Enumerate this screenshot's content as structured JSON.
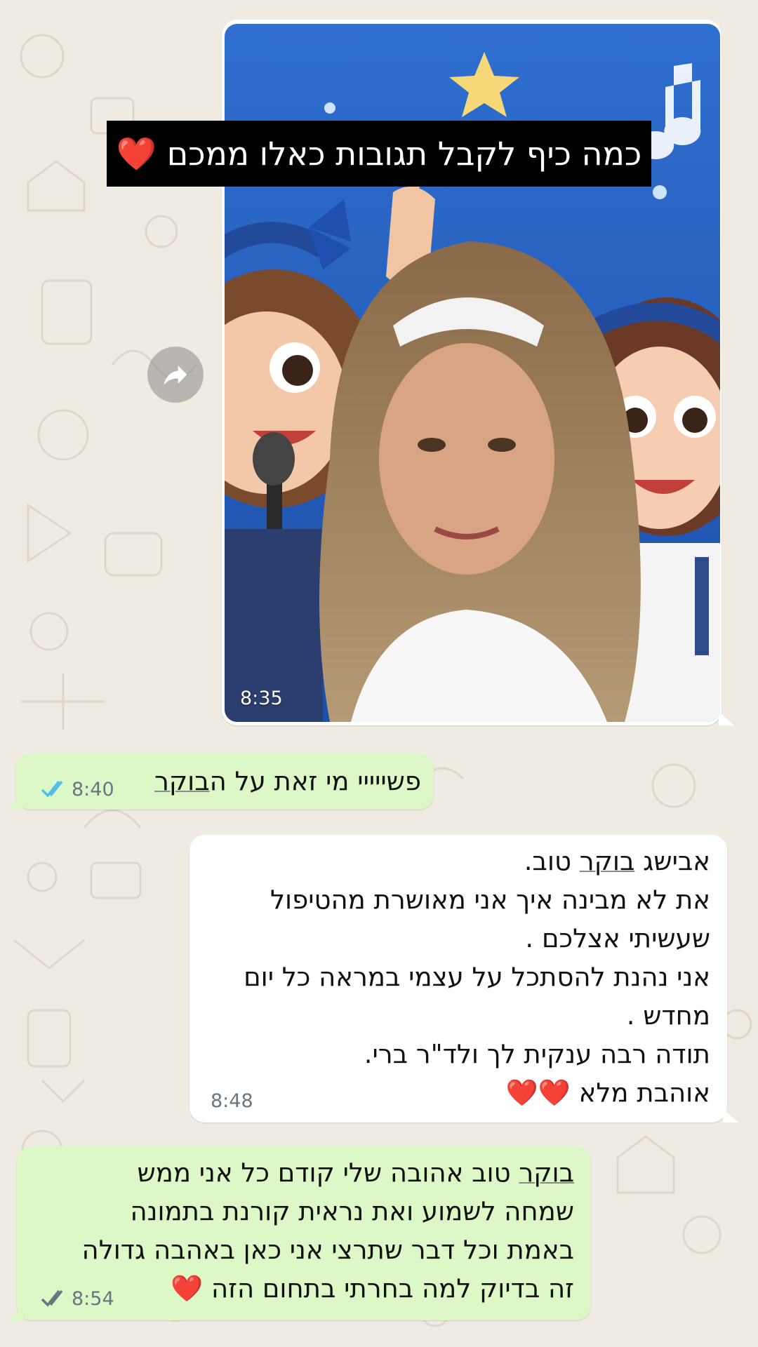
{
  "messages": [
    {
      "kind": "image",
      "direction": "incoming",
      "caption": "כמה כיף לקבל תגובות כאלו ממכם",
      "caption_emoji": "❤️",
      "time": "8:35",
      "forward_icon": "forward-arrow-icon"
    },
    {
      "kind": "text",
      "direction": "outgoing",
      "text": "פשייייי מי זאת על הבוקר",
      "time": "8:40",
      "status": "read",
      "status_icon": "double-check-icon",
      "status_color": "#53bdeb"
    },
    {
      "kind": "text",
      "direction": "incoming",
      "lines": [
        "אבישג בוקר טוב.",
        "את לא מבינה איך אני מאושרת מהטיפול",
        "שעשיתי אצלכם .",
        "אני נהנת להסתכל על עצמי במראה כל יום",
        "מחדש .",
        "תודה רבה ענקית לך ולד\"ר ברי.",
        "אוהבת מלא ❤️❤️"
      ],
      "time": "8:48"
    },
    {
      "kind": "text",
      "direction": "outgoing",
      "lines": [
        "בוקר טוב אהובה שלי קודם כל אני ממש",
        "שמחה לשמוע ואת נראית קורנת בתמונה",
        "באמת וכל דבר שתרצי אני כאן באהבה גדולה",
        "זה בדיוק למה בחרתי בתחום הזה ❤️"
      ],
      "time": "8:54",
      "status": "delivered",
      "status_icon": "double-check-icon",
      "status_color": "#667781"
    }
  ],
  "colors": {
    "wallpaper": "#efeae2",
    "incoming_bubble": "#ffffff",
    "outgoing_bubble": "#dcf8c6",
    "heart": "#e0201c"
  }
}
